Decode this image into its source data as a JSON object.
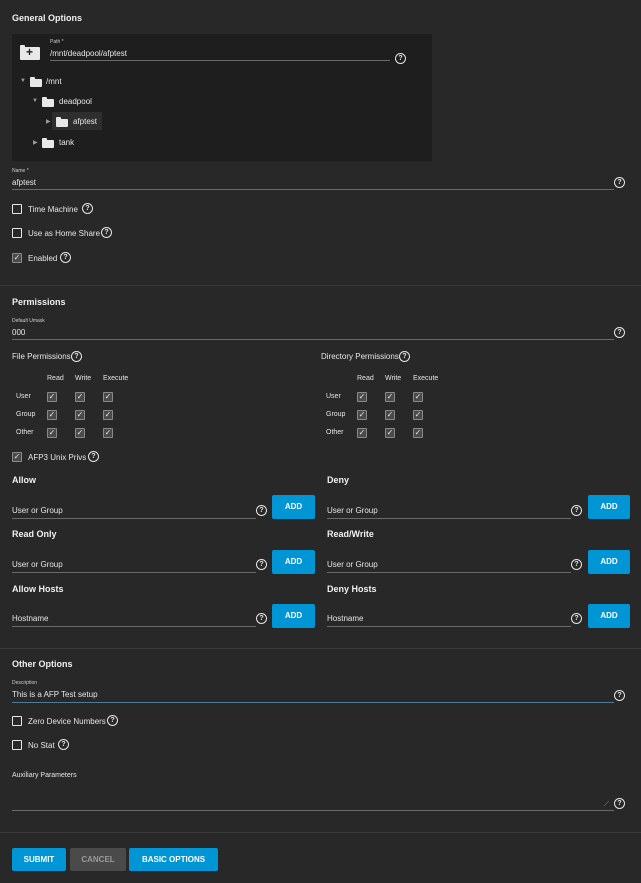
{
  "general": {
    "title": "General Options",
    "path_label": "Path *",
    "path_value": "/mnt/deadpool/afptest",
    "tree": [
      {
        "label": "/mnt",
        "expanded": true
      },
      {
        "label": "deadpool",
        "expanded": true
      },
      {
        "label": "afptest",
        "expanded": false
      },
      {
        "label": "tank",
        "expanded": false
      }
    ],
    "name_label": "Name *",
    "name_value": "afptest",
    "time_machine_label": "Time Machine",
    "time_machine_checked": false,
    "home_share_label": "Use as Home Share",
    "home_share_checked": false,
    "enabled_label": "Enabled",
    "enabled_checked": true
  },
  "permissions": {
    "title": "Permissions",
    "umask_label": "Default Umask",
    "umask_value": "000",
    "file_title": "File Permissions",
    "dir_title": "Directory Permissions",
    "columns": [
      "Read",
      "Write",
      "Execute"
    ],
    "rows": [
      "User",
      "Group",
      "Other"
    ],
    "file_matrix": [
      [
        true,
        true,
        true
      ],
      [
        true,
        true,
        true
      ],
      [
        true,
        true,
        true
      ]
    ],
    "dir_matrix": [
      [
        true,
        true,
        true
      ],
      [
        true,
        true,
        true
      ],
      [
        true,
        true,
        true
      ]
    ],
    "afp3_label": "AFP3 Unix Privs",
    "afp3_checked": true,
    "allow_title": "Allow",
    "deny_title": "Deny",
    "readonly_title": "Read Only",
    "readwrite_title": "Read/Write",
    "user_group_placeholder": "User or Group",
    "allow_hosts_title": "Allow Hosts",
    "deny_hosts_title": "Deny Hosts",
    "hostname_placeholder": "Hostname",
    "add_label": "ADD"
  },
  "other": {
    "title": "Other Options",
    "description_label": "Description",
    "description_value": "This is a AFP Test setup",
    "zero_device_label": "Zero Device Numbers",
    "zero_device_checked": false,
    "no_stat_label": "No Stat",
    "no_stat_checked": false,
    "aux_label": "Auxiliary Parameters"
  },
  "actions": {
    "submit": "SUBMIT",
    "cancel": "CANCEL",
    "basic_options": "BASIC OPTIONS"
  },
  "colors": {
    "background": "#282828",
    "accent": "#0095d5",
    "tree_background": "#1e1e1e"
  }
}
